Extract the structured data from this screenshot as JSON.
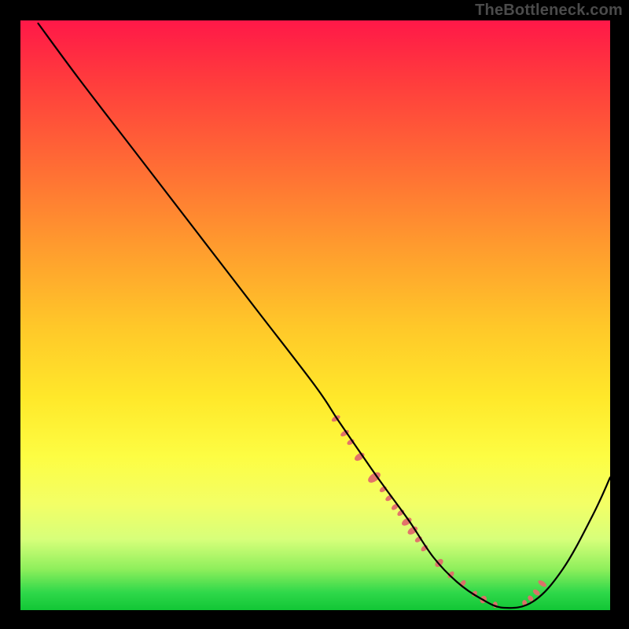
{
  "watermark": "TheBottleneck.com",
  "chart_data": {
    "type": "line",
    "title": "",
    "xlabel": "",
    "ylabel": "",
    "xlim": [
      0,
      100
    ],
    "ylim": [
      0,
      100
    ],
    "series": [
      {
        "name": "bottleneck-curve",
        "x": [
          3,
          10,
          20,
          30,
          40,
          50,
          54,
          59.5,
          62,
          66,
          70,
          74,
          78,
          82,
          87,
          92,
          97,
          100
        ],
        "values": [
          99.5,
          90,
          77,
          64,
          51,
          38,
          32,
          24,
          20.5,
          15,
          9,
          4.8,
          2,
          0.4,
          1.5,
          7,
          16,
          22.5
        ]
      }
    ],
    "marker_band": {
      "name": "gpu-marker-band",
      "color": "#e26d6a",
      "x": [
        53.5,
        55,
        56,
        57.5,
        60,
        61.5,
        62.5,
        63.5,
        64.5,
        65.5,
        66.5,
        67.5,
        68.5,
        71,
        73,
        75,
        77,
        78.5,
        80.5,
        85.5,
        86.5,
        87.5,
        88.5
      ],
      "y": [
        32.5,
        30,
        28.5,
        26,
        22.5,
        20.5,
        19,
        17.5,
        16.5,
        15,
        13.5,
        12,
        10.5,
        8,
        6,
        4.5,
        2.8,
        1.8,
        0.9,
        1.2,
        2,
        3,
        4.5
      ],
      "rx": [
        3,
        3,
        3,
        4,
        5,
        3,
        3,
        3,
        3,
        4,
        4,
        3,
        3,
        4,
        3,
        3,
        3,
        4,
        3,
        3,
        3,
        3,
        3
      ],
      "ry": [
        6,
        6,
        5,
        7,
        9,
        5,
        5,
        5,
        5,
        7,
        7,
        5,
        5,
        6,
        5,
        5,
        4,
        5,
        4,
        4,
        4,
        5,
        6
      ]
    }
  }
}
